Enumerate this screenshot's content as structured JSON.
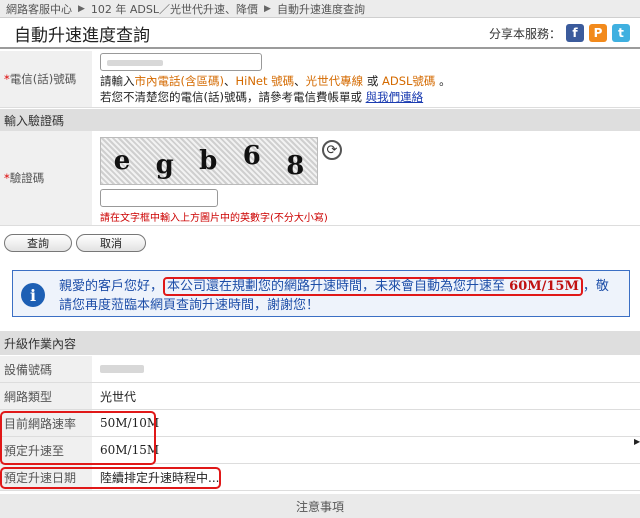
{
  "breadcrumb": [
    "網路客服中心",
    "102 年 ADSL／光世代升速、降價",
    "自動升速進度查詢"
  ],
  "breadcrumb_separator": "▶",
  "page_title": "自動升速進度查詢",
  "share": {
    "label": "分享本服務：",
    "icons": [
      {
        "name": "facebook-icon",
        "glyph": "f",
        "color": "#3b5b9c"
      },
      {
        "name": "plurk-icon",
        "glyph": "P",
        "color": "#f28a1c"
      },
      {
        "name": "twitter-icon",
        "glyph": "t",
        "color": "#3fb0e0"
      }
    ]
  },
  "phone_field": {
    "required_mark": "*",
    "label": "電信(話)號碼",
    "help_prefix": "請輸入",
    "help_part1": "市內電話(含區碼)",
    "help_sep1": "、",
    "help_part2": "HiNet 號碼",
    "help_sep2": "、",
    "help_part3": "光世代專線",
    "help_or": " 或 ",
    "help_part4": "ADSL號碼",
    "help_end": " 。",
    "help_line2": "若您不清楚您的電信(話)號碼，請參考電信費帳單或 ",
    "contact_link": "與我們連絡"
  },
  "captcha_section": {
    "title": "輸入驗證碼",
    "required_mark": "*",
    "label": "驗證碼",
    "chars": [
      "e",
      "g",
      "b",
      "6",
      "8"
    ],
    "refresh_glyph": "⟳",
    "hint": "請在文字框中輸入上方圖片中的英數字(不分大小寫)"
  },
  "buttons": {
    "query": "查詢",
    "cancel": "取消"
  },
  "notice": {
    "icon_glyph": "i",
    "text_prefix": "親愛的客戶您好，",
    "text_highlight": "本公司還在規劃您的網路升速時間，未來會自動為您升速至 ",
    "speed": "60M/15M",
    "text_suffix": "，敬請您再度蒞臨本網頁查詢升速時間，謝謝您！"
  },
  "upgrade_section": {
    "title": "升級作業內容",
    "rows": [
      {
        "label": "設備號碼",
        "value": ""
      },
      {
        "label": "網路類型",
        "value": "光世代"
      },
      {
        "label": "目前網路速率",
        "value": "50M/10M"
      },
      {
        "label": "預定升速至",
        "value": "60M/15M"
      },
      {
        "label": "預定升速日期",
        "value": "陸續排定升速時程中..."
      }
    ]
  },
  "footer": {
    "notes_title": "注意事項"
  },
  "colors": {
    "accent_red": "#e01818",
    "notice_blue": "#1d4ea8",
    "link_blue": "#1a3bb0",
    "orange": "#d46a00"
  }
}
